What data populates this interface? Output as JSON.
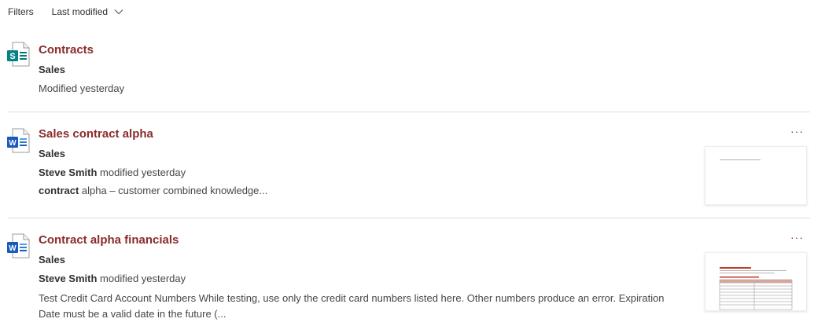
{
  "filters": {
    "label": "Filters",
    "sort_value": "Last modified"
  },
  "results": [
    {
      "title": "Contracts",
      "site": "Sales",
      "modified": "Modified yesterday",
      "icon": "sharepoint-list-icon",
      "icon_letter": "S",
      "icon_color": "#038387"
    },
    {
      "title": "Sales contract alpha",
      "site": "Sales",
      "author": "Steve Smith",
      "modified_suffix": " modified yesterday",
      "snippet_bold": "contract",
      "snippet_rest": " alpha – customer combined knowledge...",
      "more_label": "···",
      "icon": "word-doc-icon",
      "icon_letter": "W",
      "icon_color": "#185abd"
    },
    {
      "title": "Contract alpha financials",
      "site": "Sales",
      "author": "Steve Smith",
      "modified_suffix": " modified yesterday",
      "snippet": "Test Credit Card Account Numbers While testing, use only the credit card numbers listed here. Other numbers produce an error. Expiration Date must be a valid date in the future (...",
      "more_label": "···",
      "icon": "word-doc-icon",
      "icon_letter": "W",
      "icon_color": "#185abd"
    }
  ],
  "colors": {
    "title": "#8a2b2b",
    "divider": "#e1dfdd",
    "text": "#323130"
  }
}
